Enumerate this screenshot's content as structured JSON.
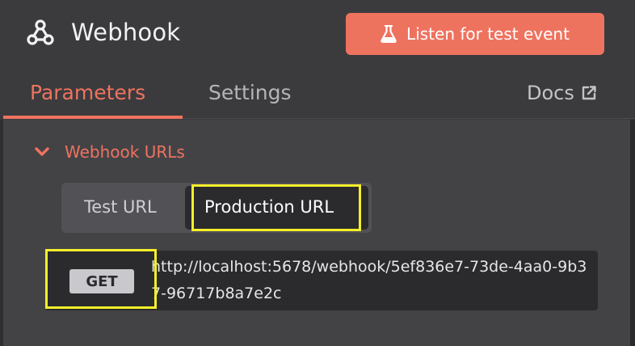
{
  "node": {
    "title": "Webhook",
    "icon": "webhook-icon"
  },
  "header": {
    "listen_button_label": "Listen for test event",
    "listen_button_icon": "flask-icon",
    "accent_color": "#ee735f"
  },
  "tabs": [
    {
      "label": "Parameters",
      "active": true
    },
    {
      "label": "Settings",
      "active": false
    }
  ],
  "docs": {
    "label": "Docs",
    "icon": "external-link-icon"
  },
  "section": {
    "title": "Webhook URLs",
    "expanded": true
  },
  "url_toggle": {
    "options": [
      "Test URL",
      "Production URL"
    ],
    "selected": "Production URL"
  },
  "webhook": {
    "method": "GET",
    "url": "http://localhost:5678/webhook/5ef836e7-73de-4aa0-9b37-96717b8a7e2c"
  },
  "highlight_color": "#f5ef2a"
}
